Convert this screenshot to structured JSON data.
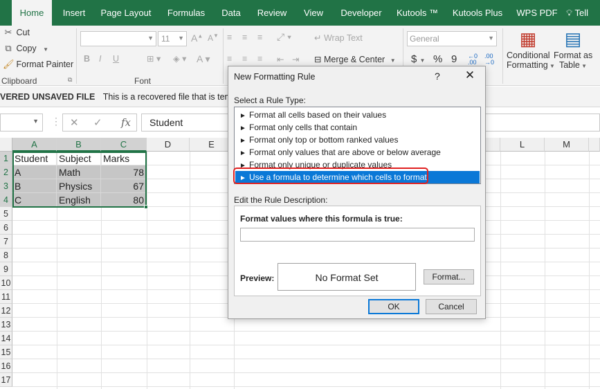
{
  "ribbon_tabs": [
    "Home",
    "Insert",
    "Page Layout",
    "Formulas",
    "Data",
    "Review",
    "View",
    "Developer",
    "Kutools ™",
    "Kutools Plus",
    "WPS PDF",
    "Tell"
  ],
  "active_tab": "Home",
  "tell_icon": "lightbulb-icon",
  "clipboard": {
    "cut": "Cut",
    "copy": "Copy",
    "format_painter": "Format Painter",
    "group": "Clipboard"
  },
  "font": {
    "size": "11",
    "group": "Font",
    "bold": "B",
    "italic": "I",
    "underline": "U"
  },
  "alignment": {
    "wrap_text": "Wrap Text",
    "merge_center": "Merge & Center"
  },
  "number": {
    "format": "General",
    "currency": "$",
    "percent": "%",
    "comma": "9"
  },
  "styles": {
    "conditional_1": "Conditional",
    "conditional_2": "Formatting",
    "format_as_1": "Format as",
    "format_as_2": "Table"
  },
  "message_bar": {
    "title": "VERED UNSAVED FILE",
    "text": "This is a recovered file that is temporar"
  },
  "formula_bar": {
    "fx": "fx",
    "value": "Student"
  },
  "columns": [
    "A",
    "B",
    "C",
    "D",
    "E",
    "L",
    "M"
  ],
  "rows": [
    "1",
    "2",
    "3",
    "4",
    "5",
    "6",
    "7",
    "8",
    "9",
    "10",
    "11",
    "12",
    "13",
    "14",
    "15",
    "16",
    "17"
  ],
  "table": {
    "headers": [
      "Student",
      "Subject",
      "Marks"
    ],
    "rows": [
      [
        "A",
        "Math",
        "78"
      ],
      [
        "B",
        "Physics",
        "67"
      ],
      [
        "C",
        "English",
        "80"
      ]
    ]
  },
  "dialog": {
    "title": "New Formatting Rule",
    "help": "?",
    "close": "✕",
    "select_label": "Select a Rule Type:",
    "rule_types": [
      "Format all cells based on their values",
      "Format only cells that contain",
      "Format only top or bottom ranked values",
      "Format only values that are above or below average",
      "Format only unique or duplicate values",
      "Use a formula to determine which cells to format"
    ],
    "selected_rule": 5,
    "edit_label": "Edit the Rule Description:",
    "formula_label": "Format values where this formula is true:",
    "formula_value": "",
    "preview_label": "Preview:",
    "preview_text": "No Format Set",
    "format_button": "Format...",
    "ok": "OK",
    "cancel": "Cancel"
  },
  "colors": {
    "excel_green": "#217346",
    "selection_blue": "#0a78d7",
    "highlight_red": "#e02020",
    "cell_shade": "#c6c6c6"
  }
}
